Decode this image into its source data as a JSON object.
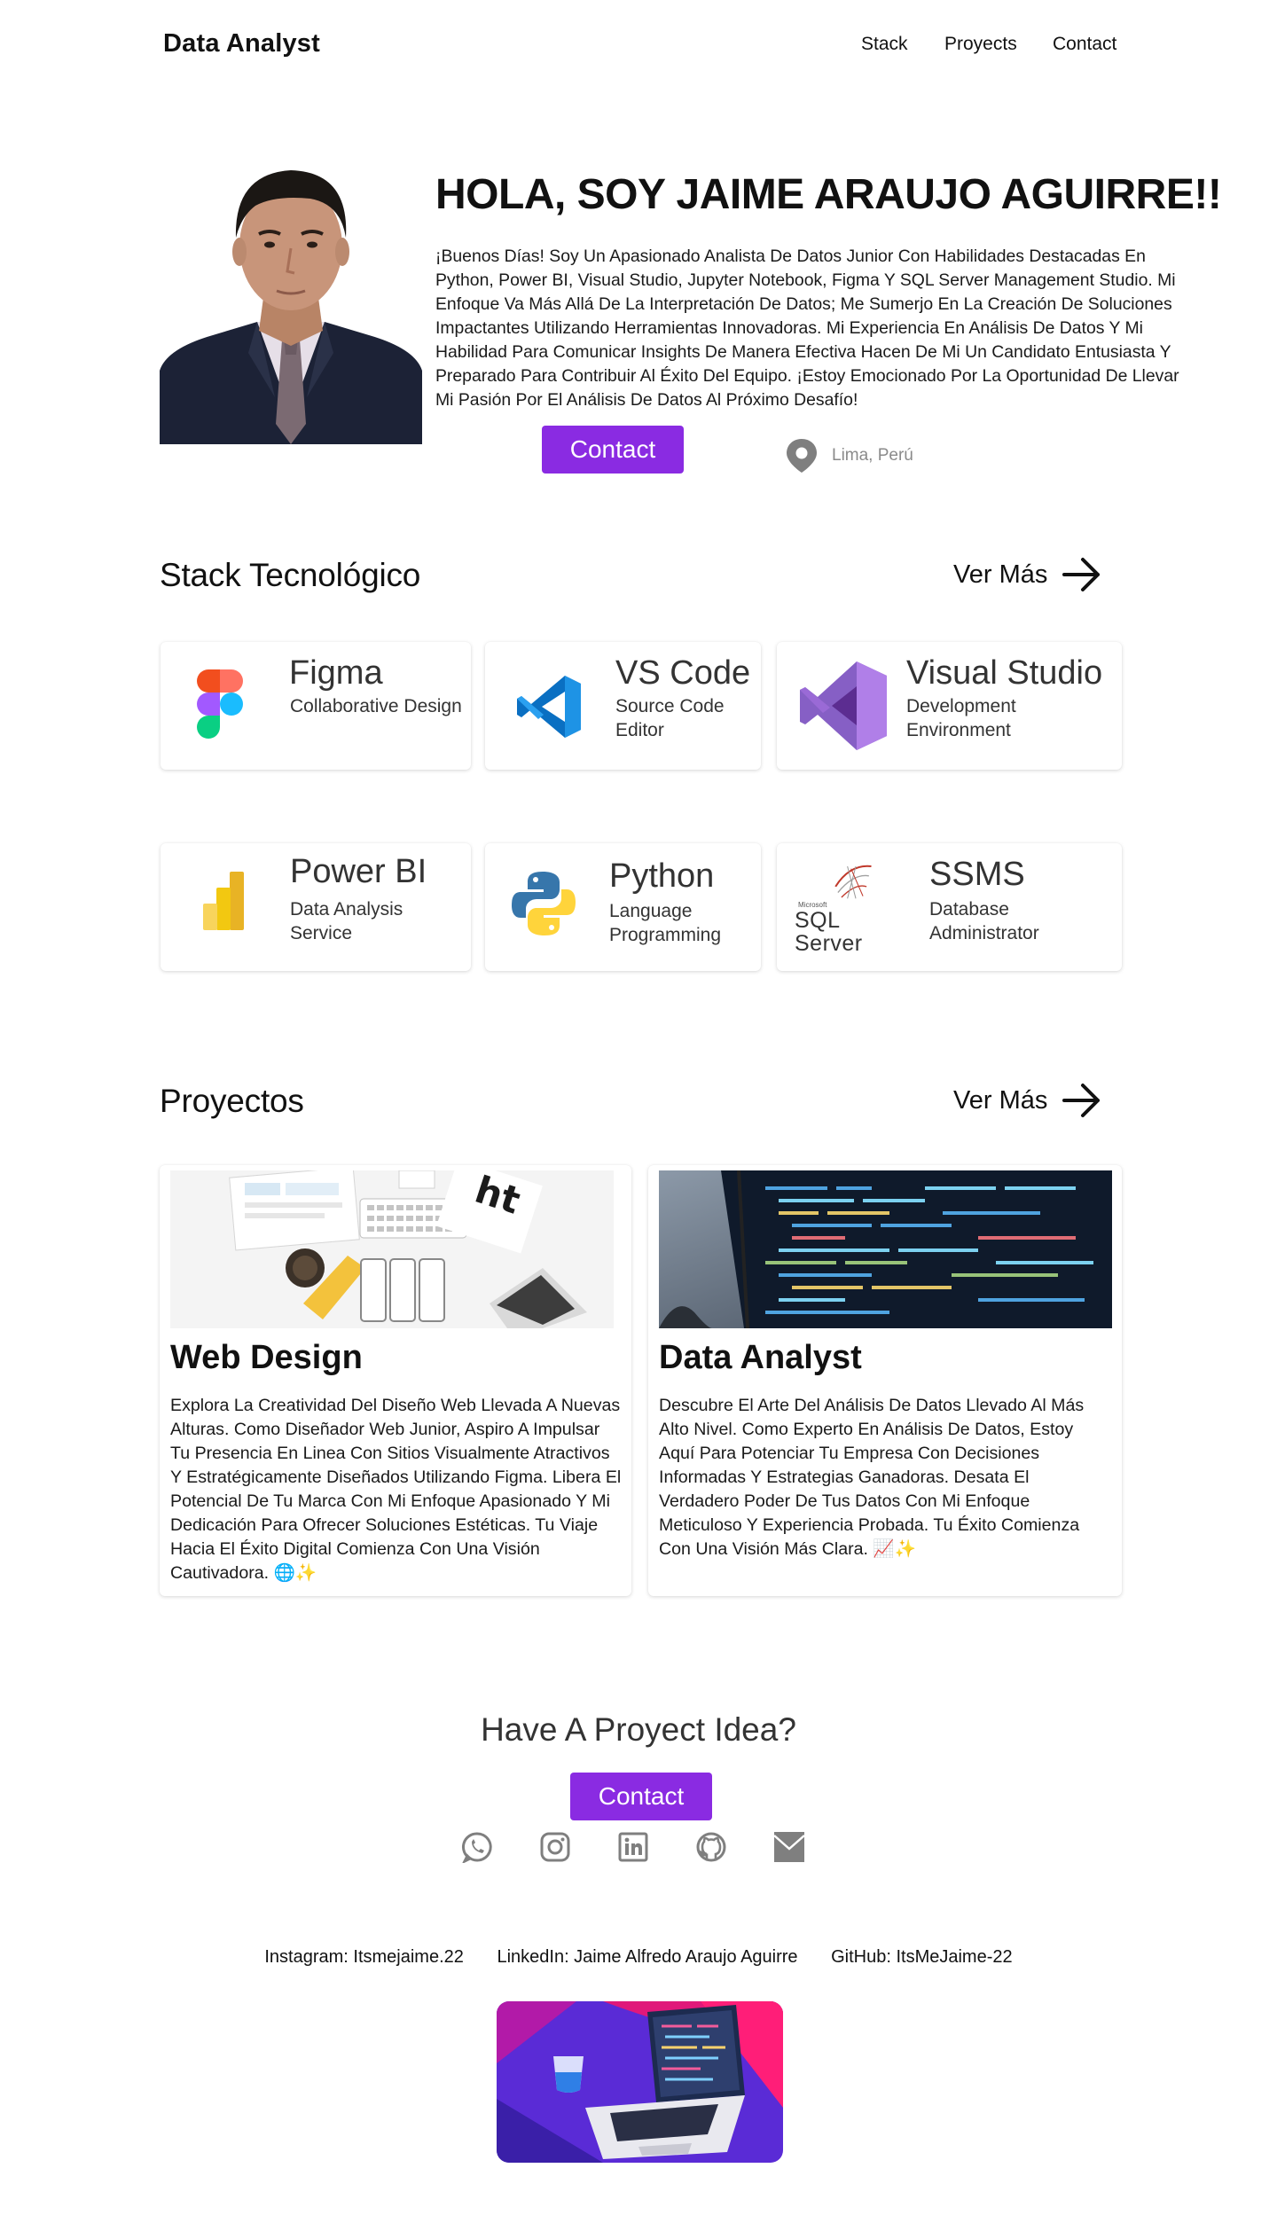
{
  "header": {
    "brand": "Data Analyst",
    "nav": [
      "Stack",
      "Proyects",
      "Contact"
    ]
  },
  "hero": {
    "title": "HOLA, SOY JAIME ARAUJO AGUIRRE!!",
    "text": "¡Buenos Días! Soy Un Apasionado Analista De Datos Junior Con Habilidades Destacadas En Python, Power BI, Visual Studio, Jupyter Notebook, Figma Y SQL Server Management Studio. Mi Enfoque Va Más Allá De La Interpretación De Datos; Me Sumerjo En La Creación De Soluciones Impactantes Utilizando Herramientas Innovadoras. Mi Experiencia En Análisis De Datos Y Mi Habilidad Para Comunicar Insights De Manera Efectiva Hacen De Mi Un Candidato Entusiasta Y Preparado Para Contribuir Al Éxito Del Equipo. ¡Estoy Emocionado Por La Oportunidad De Llevar Mi Pasión Por El Análisis De Datos Al Próximo Desafío!",
    "contact_label": "Contact",
    "location": "Lima, Perú"
  },
  "stack": {
    "title": "Stack Tecnológico",
    "more_label": "Ver Más",
    "items": [
      {
        "name": "Figma",
        "desc": "Collaborative Design"
      },
      {
        "name": "VS Code",
        "desc": "Source Code Editor"
      },
      {
        "name": "Visual Studio",
        "desc": "Development Environment"
      },
      {
        "name": "Power BI",
        "desc": "Data Analysis Service"
      },
      {
        "name": "Python",
        "desc": "Language Programming"
      },
      {
        "name": "SSMS",
        "desc": "Database Administrator"
      }
    ],
    "sql_logo_small": "Microsoft",
    "sql_logo_text": "SQL Server"
  },
  "projects": {
    "title": "Proyectos",
    "more_label": "Ver Más",
    "items": [
      {
        "title": "Web Design",
        "text": "Explora La Creatividad Del Diseño Web Llevada A Nuevas Alturas. Como Diseñador Web Junior, Aspiro A Impulsar Tu Presencia En Linea Con Sitios Visualmente Atractivos Y Estratégicamente Diseñados Utilizando Figma. Libera El Potencial De Tu Marca Con Mi Enfoque Apasionado Y Mi Dedicación Para Ofrecer Soluciones Estéticas. Tu Viaje Hacia El Éxito Digital Comienza Con Una Visión Cautivadora. 🌐✨"
      },
      {
        "title": "Data Analyst",
        "text": "Descubre El Arte Del Análisis De Datos Llevado Al Más Alto Nivel. Como Experto En Análisis De Datos, Estoy Aquí Para Potenciar Tu Empresa Con Decisiones Informadas Y Estrategias Ganadoras. Desata El Verdadero Poder De Tus Datos Con Mi Enfoque Meticuloso Y Experiencia Probada. Tu Éxito Comienza Con Una Visión Más Clara. 📈✨"
      }
    ]
  },
  "cta": {
    "title": "Have A Proyect Idea?",
    "contact_label": "Contact"
  },
  "socials": [
    "whatsapp-icon",
    "instagram-icon",
    "linkedin-icon",
    "github-icon",
    "mail-icon"
  ],
  "footer": {
    "instagram": "Instagram: Itsmejaime.22",
    "linkedin": "LinkedIn: Jaime Alfredo Araujo Aguirre",
    "github": "GitHub: ItsMeJaime-22"
  },
  "colors": {
    "accent": "#8a2be2",
    "icon_gray": "#7f7f7f"
  }
}
